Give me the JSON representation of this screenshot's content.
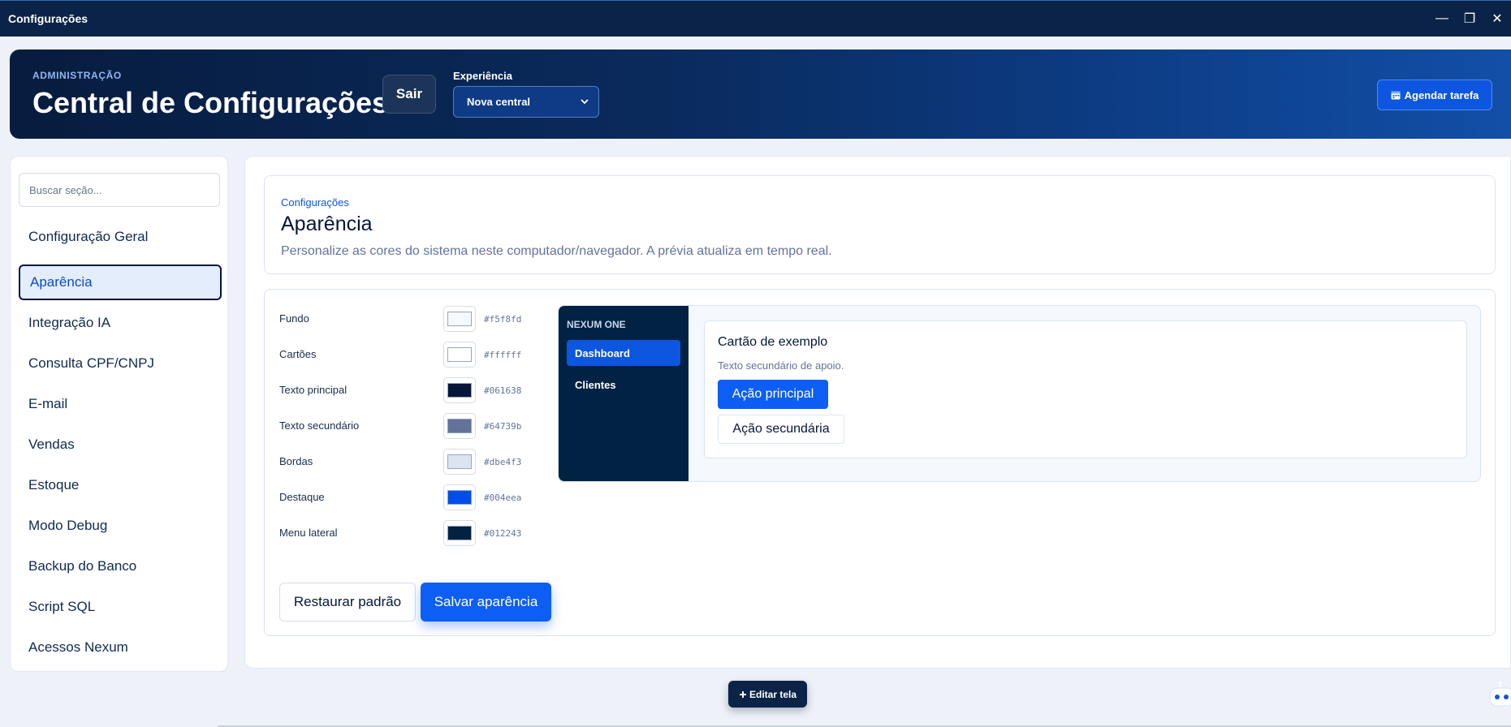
{
  "window": {
    "title": "Configurações",
    "controls": {
      "minimize": "—",
      "maximize": "❐",
      "close": "✕"
    }
  },
  "header": {
    "eyebrow": "ADMINISTRAÇÃO",
    "title": "Central de Configurações",
    "logout_label": "Sair",
    "experience_label": "Experiência",
    "experience_value": "Nova central",
    "schedule_label": "Agendar tarefa",
    "schedule_icon": "calendar-icon"
  },
  "sidebar": {
    "search_placeholder": "Buscar seção...",
    "items": [
      {
        "label": "Configuração Geral",
        "active": false
      },
      {
        "label": "Aparência",
        "active": true
      },
      {
        "label": "Integração IA",
        "active": false
      },
      {
        "label": "Consulta CPF/CNPJ",
        "active": false
      },
      {
        "label": "E-mail",
        "active": false
      },
      {
        "label": "Vendas",
        "active": false
      },
      {
        "label": "Estoque",
        "active": false
      },
      {
        "label": "Modo Debug",
        "active": false
      },
      {
        "label": "Backup do Banco",
        "active": false
      },
      {
        "label": "Script SQL",
        "active": false
      },
      {
        "label": "Acessos Nexum",
        "active": false
      }
    ]
  },
  "page": {
    "breadcrumb": "Configurações",
    "title": "Aparência",
    "subtitle": "Personalize as cores do sistema neste computador/navegador. A prévia atualiza em tempo real."
  },
  "colors": [
    {
      "label": "Fundo",
      "hex": "#f5f8fd"
    },
    {
      "label": "Cartões",
      "hex": "#ffffff"
    },
    {
      "label": "Texto principal",
      "hex": "#061638"
    },
    {
      "label": "Texto secundário",
      "hex": "#64739b"
    },
    {
      "label": "Bordas",
      "hex": "#dbe4f3"
    },
    {
      "label": "Destaque",
      "hex": "#004eea"
    },
    {
      "label": "Menu lateral",
      "hex": "#012243"
    }
  ],
  "actions": {
    "restore_label": "Restaurar padrão",
    "save_label": "Salvar aparência"
  },
  "preview": {
    "brand": "NEXUM ONE",
    "nav": [
      "Dashboard",
      "Clientes"
    ],
    "card_title": "Cartão de exemplo",
    "card_subtitle": "Texto secundário de apoio.",
    "primary_label": "Ação principal",
    "secondary_label": "Ação secundária"
  },
  "floating": {
    "edit_label": "Editar tela",
    "edit_icon": "plus-icon"
  }
}
